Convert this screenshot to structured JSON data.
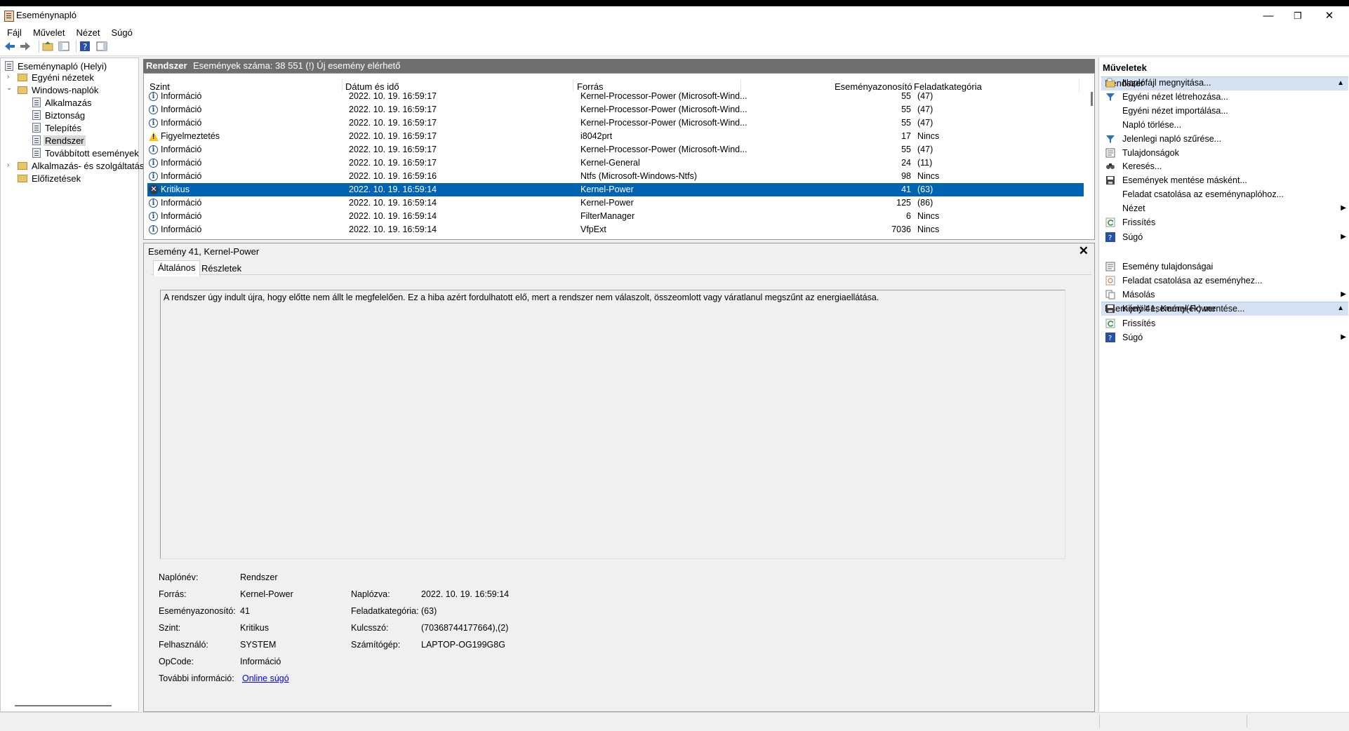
{
  "window": {
    "title": "Eseménynapló",
    "minimize": "—",
    "maximize": "❐",
    "close": "✕"
  },
  "menu": [
    "Fájl",
    "Művelet",
    "Nézet",
    "Súgó"
  ],
  "tree": {
    "root": "Eseménynapló (Helyi)",
    "custom_views": "Egyéni nézetek",
    "windows_logs": "Windows-naplók",
    "logs": [
      "Alkalmazás",
      "Biztonság",
      "Telepítés",
      "Rendszer",
      "Továbbított események"
    ],
    "app_services": "Alkalmazás- és szolgáltatásn",
    "subscriptions": "Előfizetések"
  },
  "center": {
    "log_name": "Rendszer",
    "event_count": "Események száma: 38 551 (!) Új esemény elérhető",
    "columns": [
      "Szint",
      "Dátum és idő",
      "Forrás",
      "Eseményazonosító",
      "Feladatkategória"
    ],
    "rows": [
      {
        "level": "Információ",
        "type": "info",
        "date": "2022. 10. 19. 16:59:17",
        "source": "Kernel-Processor-Power (Microsoft-Wind...",
        "id": "55",
        "cat": "(47)"
      },
      {
        "level": "Információ",
        "type": "info",
        "date": "2022. 10. 19. 16:59:17",
        "source": "Kernel-Processor-Power (Microsoft-Wind...",
        "id": "55",
        "cat": "(47)"
      },
      {
        "level": "Információ",
        "type": "info",
        "date": "2022. 10. 19. 16:59:17",
        "source": "Kernel-Processor-Power (Microsoft-Wind...",
        "id": "55",
        "cat": "(47)"
      },
      {
        "level": "Figyelmeztetés",
        "type": "warn",
        "date": "2022. 10. 19. 16:59:17",
        "source": "i8042prt",
        "id": "17",
        "cat": "Nincs"
      },
      {
        "level": "Információ",
        "type": "info",
        "date": "2022. 10. 19. 16:59:17",
        "source": "Kernel-Processor-Power (Microsoft-Wind...",
        "id": "55",
        "cat": "(47)"
      },
      {
        "level": "Információ",
        "type": "info",
        "date": "2022. 10. 19. 16:59:17",
        "source": "Kernel-General",
        "id": "24",
        "cat": "(11)"
      },
      {
        "level": "Információ",
        "type": "info",
        "date": "2022. 10. 19. 16:59:16",
        "source": "Ntfs (Microsoft-Windows-Ntfs)",
        "id": "98",
        "cat": "Nincs"
      },
      {
        "level": "Kritikus",
        "type": "crit",
        "date": "2022. 10. 19. 16:59:14",
        "source": "Kernel-Power",
        "id": "41",
        "cat": "(63)"
      },
      {
        "level": "Információ",
        "type": "info",
        "date": "2022. 10. 19. 16:59:14",
        "source": "Kernel-Power",
        "id": "125",
        "cat": "(86)"
      },
      {
        "level": "Információ",
        "type": "info",
        "date": "2022. 10. 19. 16:59:14",
        "source": "FilterManager",
        "id": "6",
        "cat": "Nincs"
      },
      {
        "level": "Információ",
        "type": "info",
        "date": "2022. 10. 19. 16:59:14",
        "source": "VfpExt",
        "id": "7036",
        "cat": "Nincs"
      }
    ]
  },
  "details": {
    "title": "Esemény 41, Kernel-Power",
    "tabs": [
      "Általános",
      "Részletek"
    ],
    "description": "A rendszer úgy indult újra, hogy előtte nem állt le megfelelően. Ez a hiba azért fordulhatott elő, mert a rendszer nem válaszolt, összeomlott vagy váratlanul megszűnt az energiaellátása.",
    "labels": {
      "log_name": "Naplónév:",
      "source": "Forrás:",
      "event_id": "Eseményazonosító:",
      "level": "Szint:",
      "user": "Felhasználó:",
      "opcode": "OpCode:",
      "more_info": "További információ:",
      "logged": "Naplózva:",
      "task_category": "Feladatkategória:",
      "keywords": "Kulcsszó:",
      "computer": "Számítógép:"
    },
    "values": {
      "log_name": "Rendszer",
      "source": "Kernel-Power",
      "event_id": "41",
      "level": "Kritikus",
      "user": "SYSTEM",
      "opcode": "Információ",
      "more_info": "Online súgó",
      "logged": "2022. 10. 19. 16:59:14",
      "task_category": "(63)",
      "keywords": "(70368744177664),(2)",
      "computer": "LAPTOP-OG199G8G"
    }
  },
  "actions": {
    "title": "Műveletek",
    "section1": "Rendszer",
    "section1_items": [
      "Naplófájl megnyitása...",
      "Egyéni nézet létrehozása...",
      "Egyéni nézet importálása...",
      "Napló törlése...",
      "Jelenlegi napló szűrése...",
      "Tulajdonságok",
      "Keresés...",
      "Események mentése másként...",
      "Feladat csatolása az eseménynaplóhoz...",
      "Nézet",
      "Frissítés",
      "Súgó"
    ],
    "section2": "Esemény 41, Kernel-Power",
    "section2_items": [
      "Esemény tulajdonságai",
      "Feladat csatolása az eseményhez...",
      "Másolás",
      "Kijelölt esemény(ek) mentése...",
      "Frissítés",
      "Súgó"
    ]
  }
}
